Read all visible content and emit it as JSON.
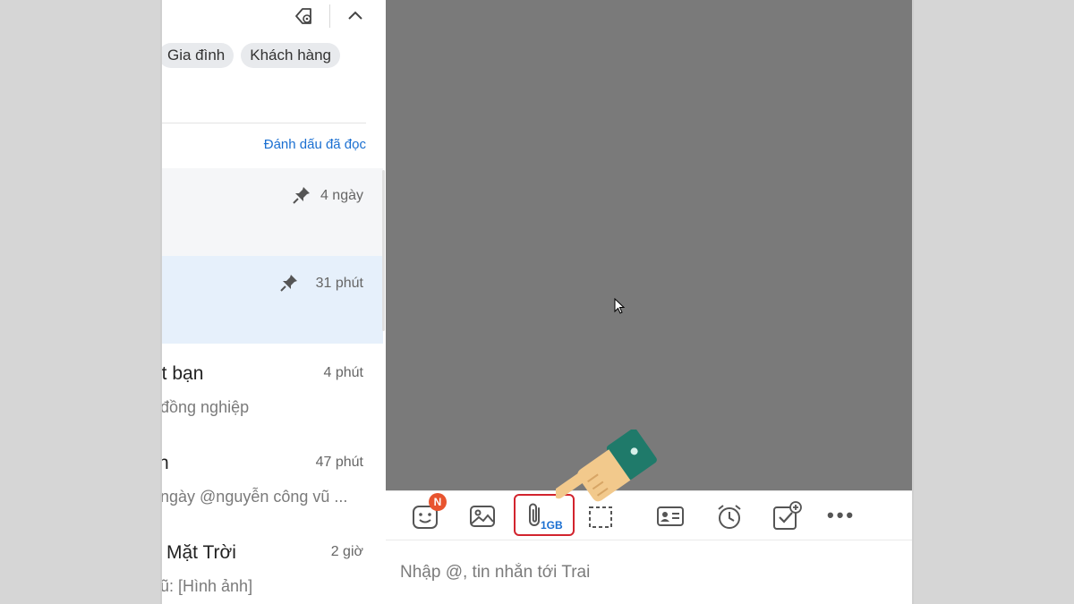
{
  "tags": [
    "Gia đình",
    "Khách hàng"
  ],
  "mark_read_label": "Đánh dấu đã đọc",
  "conversations": [
    {
      "name": "",
      "preview": "",
      "time": "4 ngày",
      "pinned": true
    },
    {
      "name": "",
      "preview": "",
      "time": "31 phút",
      "pinned": true,
      "active": true
    },
    {
      "name": "ết bạn",
      "preview": "đồng nghiệp",
      "time": "4 phút"
    },
    {
      "name": "h",
      "preview": "ngày @nguyễn công vũ ...",
      "time": "47 phút"
    },
    {
      "name": "Mặt Trời",
      "preview": "ũ: [Hình ảnh]",
      "time": "2 giờ"
    }
  ],
  "toolbar": {
    "sticker_badge": "N",
    "attach_size": "1GB"
  },
  "composer": {
    "placeholder": "Nhập @, tin nhắn tới Trai"
  },
  "colors": {
    "accent": "#1a6fd1",
    "highlight_border": "#d2242e",
    "badge": "#e8542f",
    "chat_background": "#7a7a7a",
    "active_row": "#e6f0fb"
  }
}
